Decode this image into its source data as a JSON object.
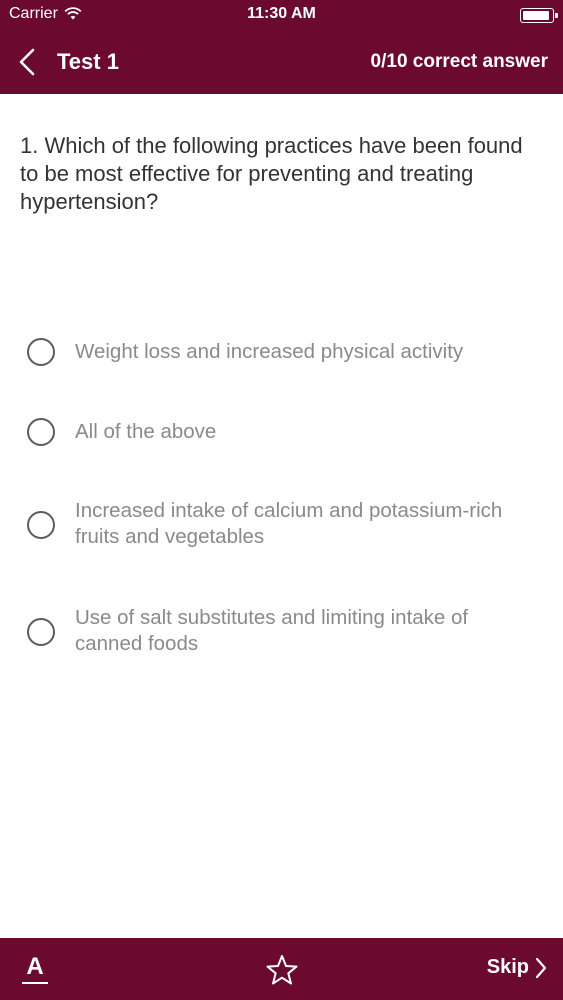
{
  "status_bar": {
    "carrier": "Carrier",
    "time": "11:30 AM",
    "icons": [
      "wifi-icon",
      "battery-icon"
    ]
  },
  "nav": {
    "title": "Test 1",
    "score": "0/10 correct answer",
    "back_icon": "chevron-left-icon"
  },
  "question": {
    "text": "1. Which of the following practices have been found to be most effective for preventing and treating hypertension?"
  },
  "options": [
    {
      "label": "Weight loss and increased physical activity",
      "selected": false
    },
    {
      "label": "All of the above",
      "selected": false
    },
    {
      "label": "Increased intake of calcium and potassium-rich fruits and vegetables",
      "selected": false
    },
    {
      "label": "Use of salt substitutes and limiting intake of canned foods",
      "selected": false
    }
  ],
  "bottom_bar": {
    "font_icon_letter": "A",
    "star_icon": "star-outline-icon",
    "skip_label": "Skip",
    "skip_icon": "chevron-right-icon"
  },
  "colors": {
    "brand": "#6b0a2e",
    "option_text": "#8a8a8a",
    "question_text": "#333333"
  }
}
